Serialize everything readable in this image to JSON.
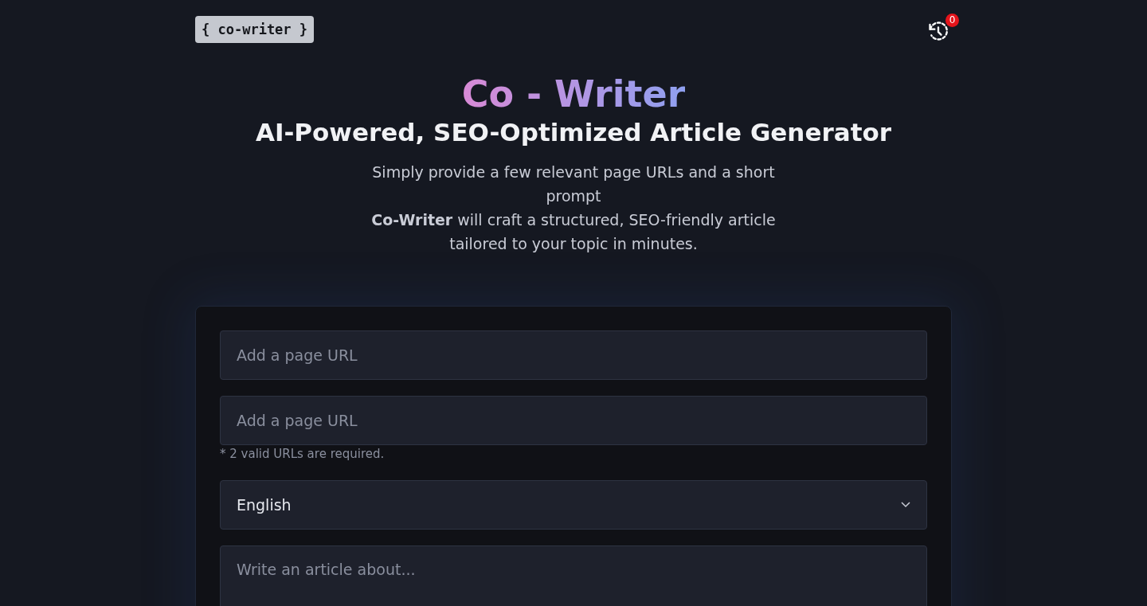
{
  "header": {
    "logo": "{ co-writer }",
    "history_badge": "0"
  },
  "hero": {
    "title": "Co - Writer",
    "subtitle": "AI-Powered, SEO-Optimized Article Generator",
    "description": [
      "Simply provide a few relevant page URLs and a short prompt",
      "**Co-Writer** will craft a structured, SEO-friendly article tailored to your topic in minutes."
    ]
  },
  "form": {
    "url_fields": [
      {
        "placeholder": "Add a page URL"
      },
      {
        "placeholder": "Add a page URL"
      }
    ],
    "url_hint": "* 2 valid URLs are required.",
    "language": {
      "value": "English"
    },
    "prompt": {
      "placeholder": "Write an article about..."
    }
  }
}
